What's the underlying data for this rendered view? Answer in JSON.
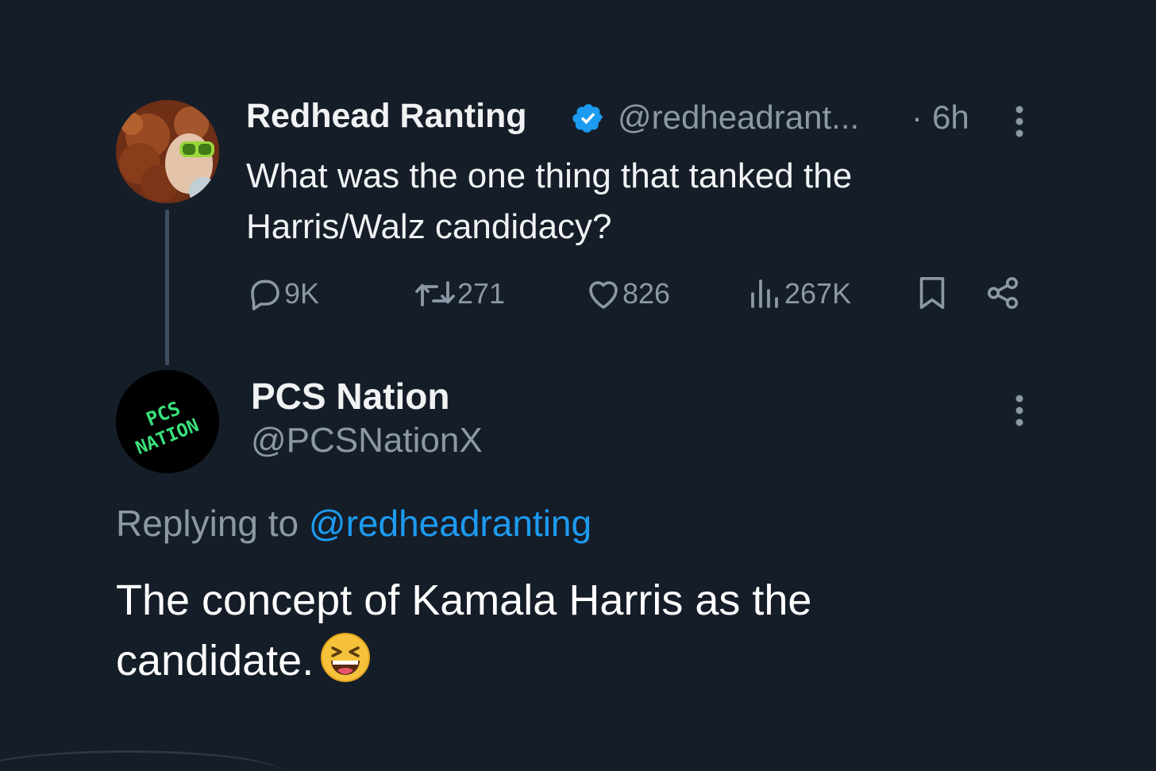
{
  "parent_tweet": {
    "author_name": "Redhead Ranting",
    "handle": "@redheadrant...",
    "separator": "·",
    "time": "6h",
    "text_line1": "What was the one thing that tanked the",
    "text_line2": "Harris/Walz candidacy?",
    "stats": {
      "replies": "9K",
      "retweets": "271",
      "likes": "826",
      "views": "267K"
    }
  },
  "reply_tweet": {
    "author_name": "PCS Nation",
    "handle": "@PCSNationX",
    "avatar_text_line1": "PCS",
    "avatar_text_line2": "NATION",
    "replying_prefix": "Replying to ",
    "replying_mention": "@redheadranting",
    "text_line1": "The concept of Kamala Harris as the",
    "text_line2": "candidate.",
    "emoji": "grinning-squinting-face"
  },
  "colors": {
    "background": "#151d28",
    "primary_text": "#f0f2f3",
    "secondary_text": "#8b98a5",
    "accent": "#1d9bf0",
    "verified_badge": "#1d9bf0",
    "avatar2_text": "#39e07a"
  }
}
